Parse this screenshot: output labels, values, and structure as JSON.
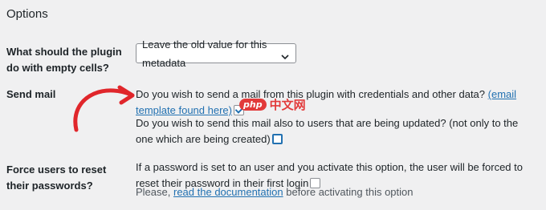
{
  "section": {
    "title": "Options"
  },
  "empty_cells": {
    "label": "What should the plugin do with empty cells?",
    "selected": "Leave the old value for this metadata"
  },
  "send_mail": {
    "label": "Send mail",
    "option1_text": "Do you wish to send a mail from this plugin with credentials and other data?",
    "option1_link": "(email template found here)",
    "option1_checked": true,
    "option2_text": "Do you wish to send this mail also to users that are being updated? (not only to the one which are being created)",
    "option2_checked": false
  },
  "force_reset": {
    "label": "Force users to reset their passwords?",
    "text": "If a password is set to an user and you activate this option, the user will be forced to reset their password in their first login",
    "hint_prefix": "Please,",
    "hint_link": "read the documentation",
    "hint_suffix": "before activating this option"
  },
  "watermark": {
    "badge": "php",
    "text": "中文网"
  },
  "colors": {
    "link": "#2271b1",
    "arrow": "#e0262b",
    "background": "#f0f0f1"
  }
}
